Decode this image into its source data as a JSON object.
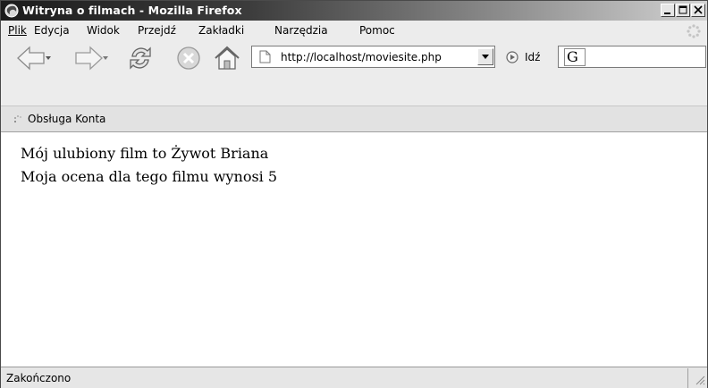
{
  "window": {
    "title": "Witryna o filmach - Mozilla Firefox"
  },
  "menu": {
    "items": [
      "Plik",
      "Edycja",
      "Widok",
      "Przejdź",
      "Zakładki",
      "Narzędzia",
      "Pomoc"
    ]
  },
  "navigation": {
    "url": "http://localhost/moviesite.php",
    "go_label": "Idź",
    "search_engine_glyph": "G"
  },
  "bookmarks": {
    "items": [
      "Obsługa Konta"
    ]
  },
  "content": {
    "lines": [
      "Mój ulubiony film to Żywot Briana",
      "Moja ocena dla tego filmu wynosi 5"
    ]
  },
  "status": {
    "text": "Zakończono"
  },
  "icons": {
    "title": "firefox-icon",
    "back": "back-arrow-icon",
    "forward": "forward-arrow-icon",
    "reload": "reload-icon",
    "stop": "stop-icon",
    "home": "home-icon",
    "page": "page-icon",
    "go": "go-icon",
    "bookmark": "bookmark-icon",
    "throbber": "throbber-icon"
  }
}
